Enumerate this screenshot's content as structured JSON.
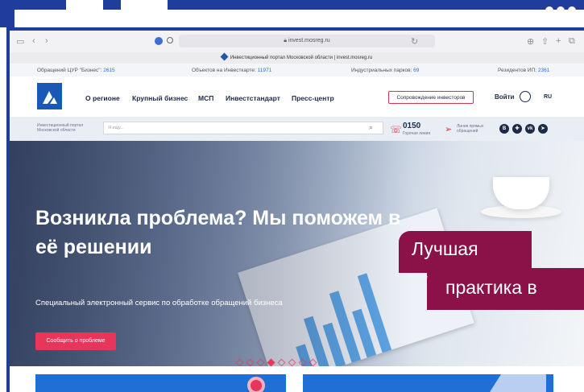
{
  "browser": {
    "url": "invest.mosreg.ru",
    "tab_title": "Инвестиционный портал Московской области | invest.mosreg.ru"
  },
  "stats": {
    "appeals_label": "Обращений ЦУР \"Бизнес\":",
    "appeals_value": "2615",
    "objects_label": "Объектов на Инвесткарте:",
    "objects_value": "11971",
    "parks_label": "Индустриальных парков:",
    "parks_value": "69",
    "residents_label": "Резидентов ИП:",
    "residents_value": "2361"
  },
  "nav": {
    "items": [
      "О регионе",
      "Крупный бизнес",
      "МСП",
      "Инвестстандарт",
      "Пресс-центр"
    ],
    "cta": "Сопровождение инвесторов",
    "login": "Войти",
    "lang": "RU"
  },
  "searchbar": {
    "portal_label": "Инвестиционный портал Московской области",
    "search_placeholder": "Я ищу...",
    "phone": "0150",
    "phone_sub": "Горячая линия",
    "direct_label": "Линия прямых обращений"
  },
  "hero": {
    "title": "Возникла проблема? Мы поможем в её решении",
    "subtitle": "Специальный электронный сервис по обработке обращений бизнеса",
    "button": "Сообщить о проблеме",
    "slides_total": 8,
    "slide_active": 4
  },
  "overlay": {
    "line1": "Лучшая",
    "line2": "практика в"
  },
  "colors": {
    "frame_blue": "#1f3d9c",
    "accent_red": "#e8365a",
    "callout_maroon": "#8a1248",
    "brand_blue": "#1958b7"
  }
}
